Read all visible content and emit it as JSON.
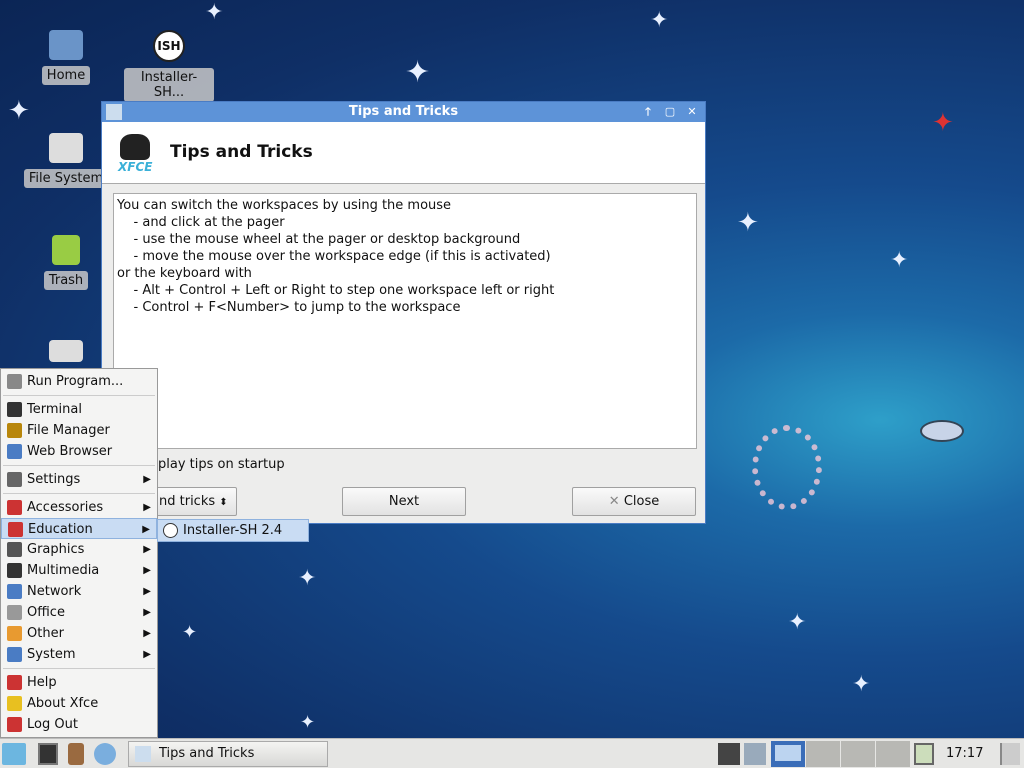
{
  "desktop": {
    "icons": [
      {
        "label": "Home"
      },
      {
        "label": "Installer-SH..."
      },
      {
        "label": "File System"
      },
      {
        "label": "Trash"
      }
    ],
    "installer_badge": "ISH"
  },
  "dialog": {
    "title": "Tips and Tricks",
    "heading": "Tips and Tricks",
    "tip_text": "You can switch the workspaces by using the mouse\n    - and click at the pager\n    - use the mouse wheel at the pager or desktop background\n    - move the mouse over the workspace edge (if this is activated)\nor the keyboard with\n    - Alt + Control + Left or Right to step one workspace left or right\n    - Control + F<Number> to jump to the workspace",
    "checkbox_label": "Display tips on startup",
    "checkbox_visible": "play tips on startup",
    "combo_value": "nd tricks",
    "next_label": "Next",
    "close_label": "Close"
  },
  "menu": {
    "items": [
      {
        "label": "Run Program...",
        "color": "#888"
      },
      {
        "label": "Terminal",
        "color": "#333"
      },
      {
        "label": "File Manager",
        "color": "#b8860b"
      },
      {
        "label": "Web Browser",
        "color": "#4a7cc4"
      },
      {
        "label": "Settings",
        "color": "#666",
        "sub": true
      },
      {
        "label": "Accessories",
        "color": "#c33",
        "sub": true
      },
      {
        "label": "Education",
        "color": "#c33",
        "sub": true
      },
      {
        "label": "Graphics",
        "color": "#555",
        "sub": true
      },
      {
        "label": "Multimedia",
        "color": "#333",
        "sub": true
      },
      {
        "label": "Network",
        "color": "#4a7cc4",
        "sub": true
      },
      {
        "label": "Office",
        "color": "#999",
        "sub": true
      },
      {
        "label": "Other",
        "color": "#e89a30",
        "sub": true
      },
      {
        "label": "System",
        "color": "#4a7cc4",
        "sub": true
      },
      {
        "label": "Help",
        "color": "#c33"
      },
      {
        "label": "About Xfce",
        "color": "#e8c020"
      },
      {
        "label": "Log Out",
        "color": "#c33"
      }
    ],
    "submenu": {
      "label": "Installer-SH 2.4"
    }
  },
  "taskbar": {
    "task_label": "Tips and Tricks",
    "clock": "17:17"
  }
}
